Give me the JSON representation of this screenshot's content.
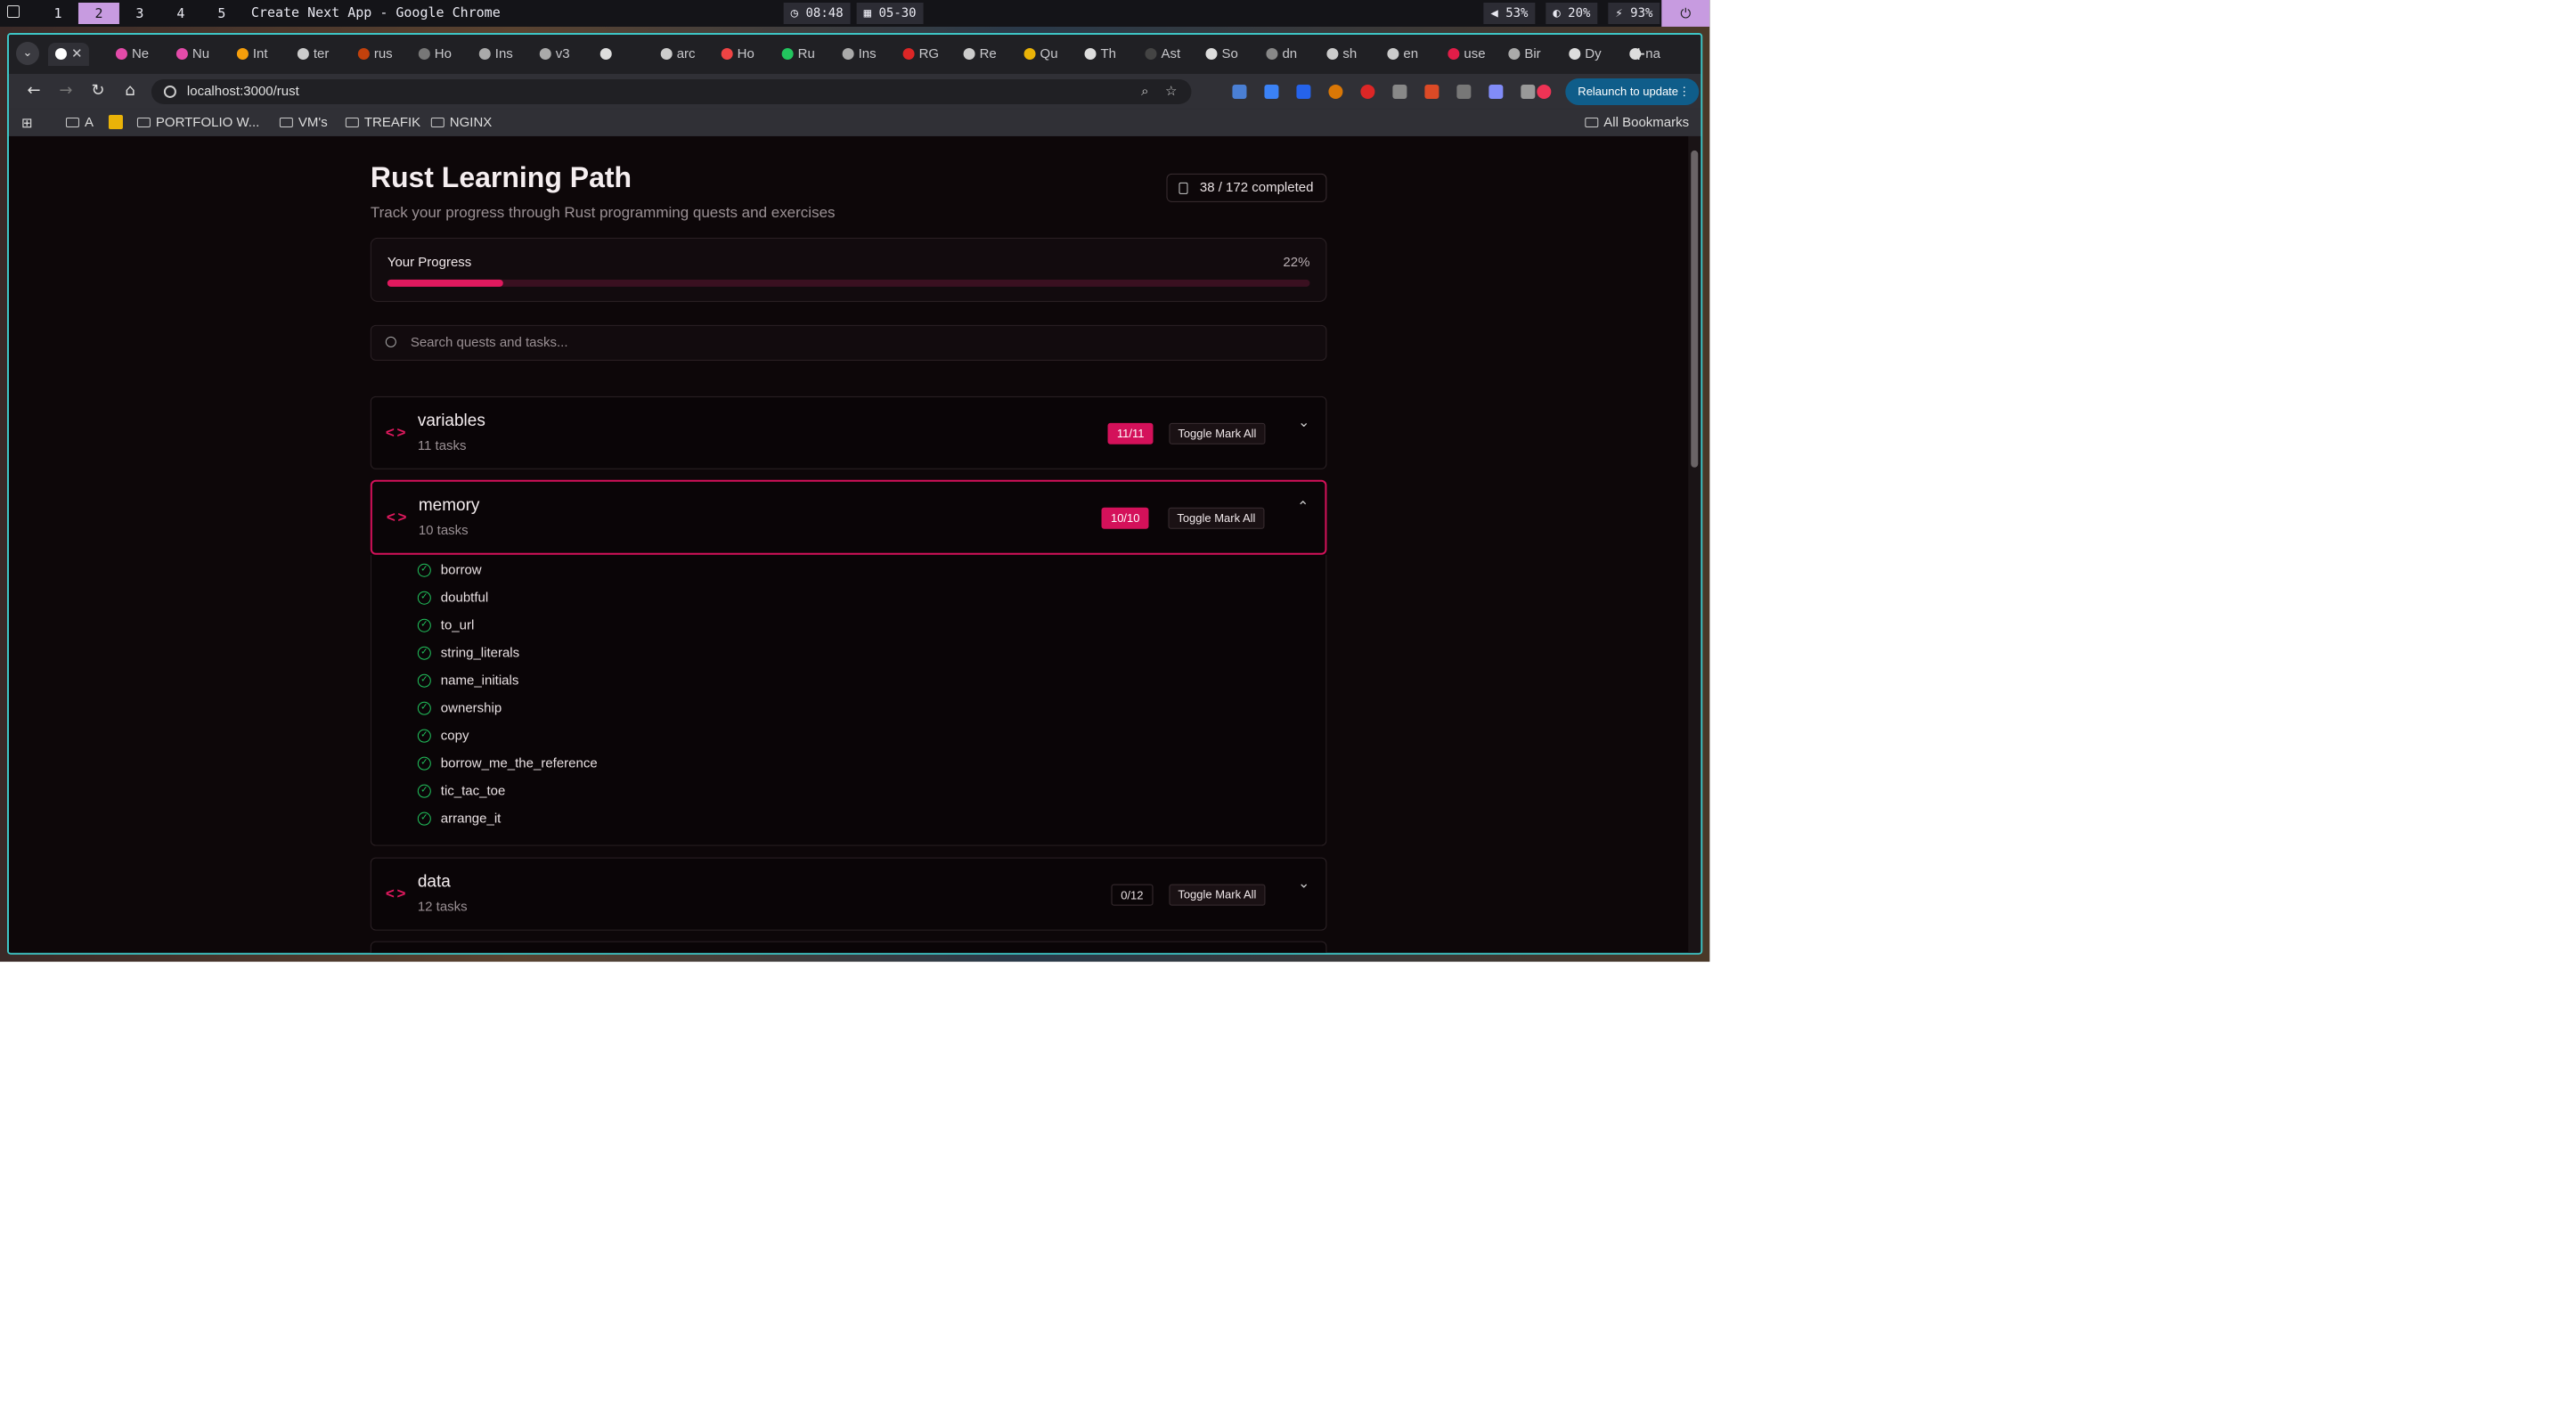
{
  "wm": {
    "workspaces": [
      "1",
      "2",
      "3",
      "4",
      "5"
    ],
    "active_workspace": "2",
    "window_title": "Create Next App - Google Chrome",
    "clock": "08:48",
    "date": "05-30",
    "volume": "53%",
    "brightness": "20%",
    "battery": "93%"
  },
  "browser": {
    "tabs": [
      "Ne",
      "Nu",
      "Int",
      "ter",
      "rus",
      "Ho",
      "Ins",
      "v3",
      "",
      "arc",
      "Ho",
      "Ru",
      "Ins",
      "RG",
      "Re",
      "Qu",
      "Th",
      "Ast",
      "So",
      "dn",
      "sh",
      "en",
      "usе",
      "Bir",
      "Dy",
      "na"
    ],
    "address": "localhost:3000/rust",
    "relaunch_label": "Relaunch to update",
    "bookmarks": [
      "A",
      "PORTFOLIO W...",
      "VM's",
      "TREAFIK",
      "NGINX"
    ],
    "all_bookmarks": "All Bookmarks"
  },
  "page": {
    "title": "Rust Learning Path",
    "subtitle": "Track your progress through Rust programming quests and exercises",
    "completed": "38 / 172 completed",
    "progress_label": "Your Progress",
    "progress_pct_text": "22%",
    "progress_fraction": 0.22,
    "search_placeholder": "Search quests and tasks...",
    "quests": [
      {
        "name": "variables",
        "count": "11 tasks",
        "badge": "11/11",
        "toggle": "Toggle Mark All",
        "open": false
      },
      {
        "name": "memory",
        "count": "10 tasks",
        "badge": "10/10",
        "toggle": "Toggle Mark All",
        "open": true,
        "tasks": [
          "borrow",
          "doubtful",
          "to_url",
          "string_literals",
          "name_initials",
          "ownership",
          "copy",
          "borrow_me_the_reference",
          "tic_tac_toe",
          "arrange_it"
        ]
      },
      {
        "name": "data",
        "count": "12 tasks",
        "badge": "0/12",
        "toggle": "Toggle Mark All",
        "open": false
      }
    ]
  },
  "colors": {
    "accent": "#e0195e",
    "check": "#22c55e",
    "page_bg": "#0d0709"
  }
}
